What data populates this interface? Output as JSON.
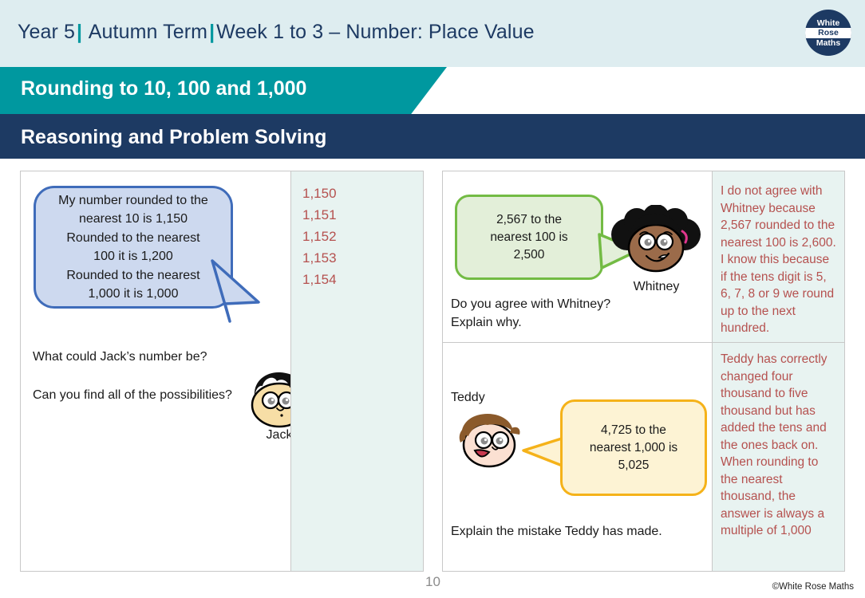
{
  "header": {
    "year": "Year 5",
    "term": "Autumn Term",
    "week": "Week 1 to 3 – Number: Place Value",
    "separator": "|",
    "logo": {
      "line1": "White",
      "line2": "Rose",
      "line3": "Maths"
    }
  },
  "banners": {
    "topic": "Rounding to 10, 100 and 1,000",
    "section": "Reasoning and Problem Solving"
  },
  "left_panel": {
    "bubble": {
      "speaker": "Jack",
      "line1": "My number rounded to the",
      "line2": "nearest 10 is 1,150",
      "line3": "Rounded to the nearest",
      "line4": "100 it is 1,200",
      "line5": "Rounded to the nearest",
      "line6": "1,000 it is 1,000"
    },
    "question1": "What could Jack’s number be?",
    "question2": "Can you find all of the possibilities?",
    "answers": [
      "1,150",
      "1,151",
      "1,152",
      "1,153",
      "1,154"
    ]
  },
  "right_panel": {
    "whitney": {
      "speaker": "Whitney",
      "bubble_line1": "2,567 to the",
      "bubble_line2": "nearest 100 is",
      "bubble_line3": "2,500",
      "question_line1": "Do you agree with Whitney?",
      "question_line2": "Explain why.",
      "answer": "I do not agree with Whitney because 2,567 rounded to the nearest 100 is 2,600. I know this because if the tens digit is 5, 6, 7, 8 or 9 we round up to the next hundred."
    },
    "teddy": {
      "speaker": "Teddy",
      "bubble_line1": "4,725 to the",
      "bubble_line2": "nearest 1,000 is",
      "bubble_line3": "5,025",
      "question": "Explain the mistake Teddy has made.",
      "answer": "Teddy has correctly changed four thousand to five thousand but has added the tens and the ones back on. When rounding to the nearest thousand, the answer is always a multiple of 1,000"
    }
  },
  "footer": {
    "page_number": "10",
    "copyright": "©White Rose Maths"
  },
  "colors": {
    "header_bg": "#deedf0",
    "teal": "#00989f",
    "navy": "#1d3a63",
    "answer_bg": "#e8f3f1",
    "answer_text": "#b5514f",
    "jack_bubble_fill": "#cdd9ef",
    "jack_bubble_border": "#3f6cba",
    "whitney_bubble_fill": "#e3efd9",
    "whitney_bubble_border": "#73bb44",
    "teddy_bubble_fill": "#fdf3d4",
    "teddy_bubble_border": "#f5b219"
  }
}
